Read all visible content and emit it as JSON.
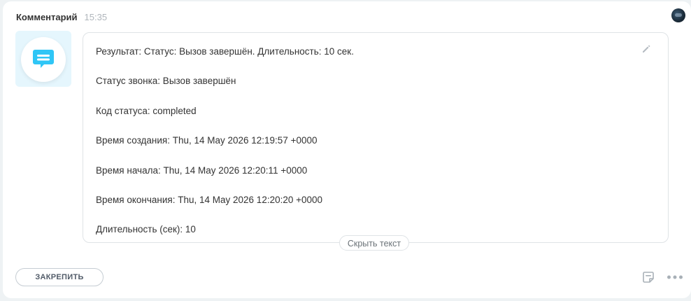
{
  "header": {
    "title": "Комментарий",
    "time": "15:35"
  },
  "comment": {
    "lines": [
      "Результат: Статус: Вызов завершён. Длительность: 10 сек.",
      "Статус звонка: Вызов завершён",
      "Код статуса: completed",
      "Время создания: Thu, 14 May 2026 12:19:57 +0000",
      "Время начала: Thu, 14 May 2026 12:20:11 +0000",
      "Время окончания: Thu, 14 May 2026 12:20:20 +0000",
      "Длительность (сек): 10"
    ],
    "toggle_label": "Скрыть текст"
  },
  "actions": {
    "pin_label": "ЗАКРЕПИТЬ"
  },
  "icons": {
    "type_icon": "chat-bubble-icon",
    "edit_icon": "pencil-icon",
    "note_icon": "note-icon",
    "more_icon": "more-dots-icon"
  },
  "colors": {
    "accent": "#2fc6f6",
    "icon_bg": "#e5f6fd"
  }
}
